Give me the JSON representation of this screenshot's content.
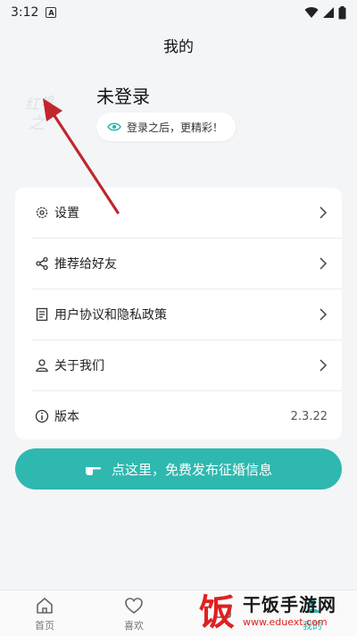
{
  "status_bar": {
    "time": "3:12",
    "a_badge": "A"
  },
  "header": {
    "title": "我的"
  },
  "profile": {
    "title": "未登录",
    "hint": "登录之后，更精彩！",
    "avatar_text": "红娘之"
  },
  "menu": {
    "items": [
      {
        "label": "设置",
        "icon": "gear-icon"
      },
      {
        "label": "推荐给好友",
        "icon": "share-icon"
      },
      {
        "label": "用户协议和隐私政策",
        "icon": "document-icon"
      },
      {
        "label": "关于我们",
        "icon": "person-icon"
      },
      {
        "label": "版本",
        "icon": "info-icon",
        "value": "2.3.22"
      }
    ]
  },
  "cta": {
    "label": "点这里，免费发布征婚信息",
    "color": "#2fb8b0"
  },
  "tabbar": {
    "tabs": [
      {
        "label": "首页",
        "icon": "home-icon"
      },
      {
        "label": "喜欢",
        "icon": "heart-icon"
      },
      {
        "label": "",
        "icon": "message-icon"
      },
      {
        "label": "我的",
        "icon": "user-icon"
      }
    ]
  },
  "watermark": {
    "title": "干饭手游网",
    "url": "www.eduext.com",
    "logo_char": "饭"
  },
  "colors": {
    "accent": "#2fb8b0",
    "arrow": "#c0272d",
    "background": "#f4f5f7"
  }
}
